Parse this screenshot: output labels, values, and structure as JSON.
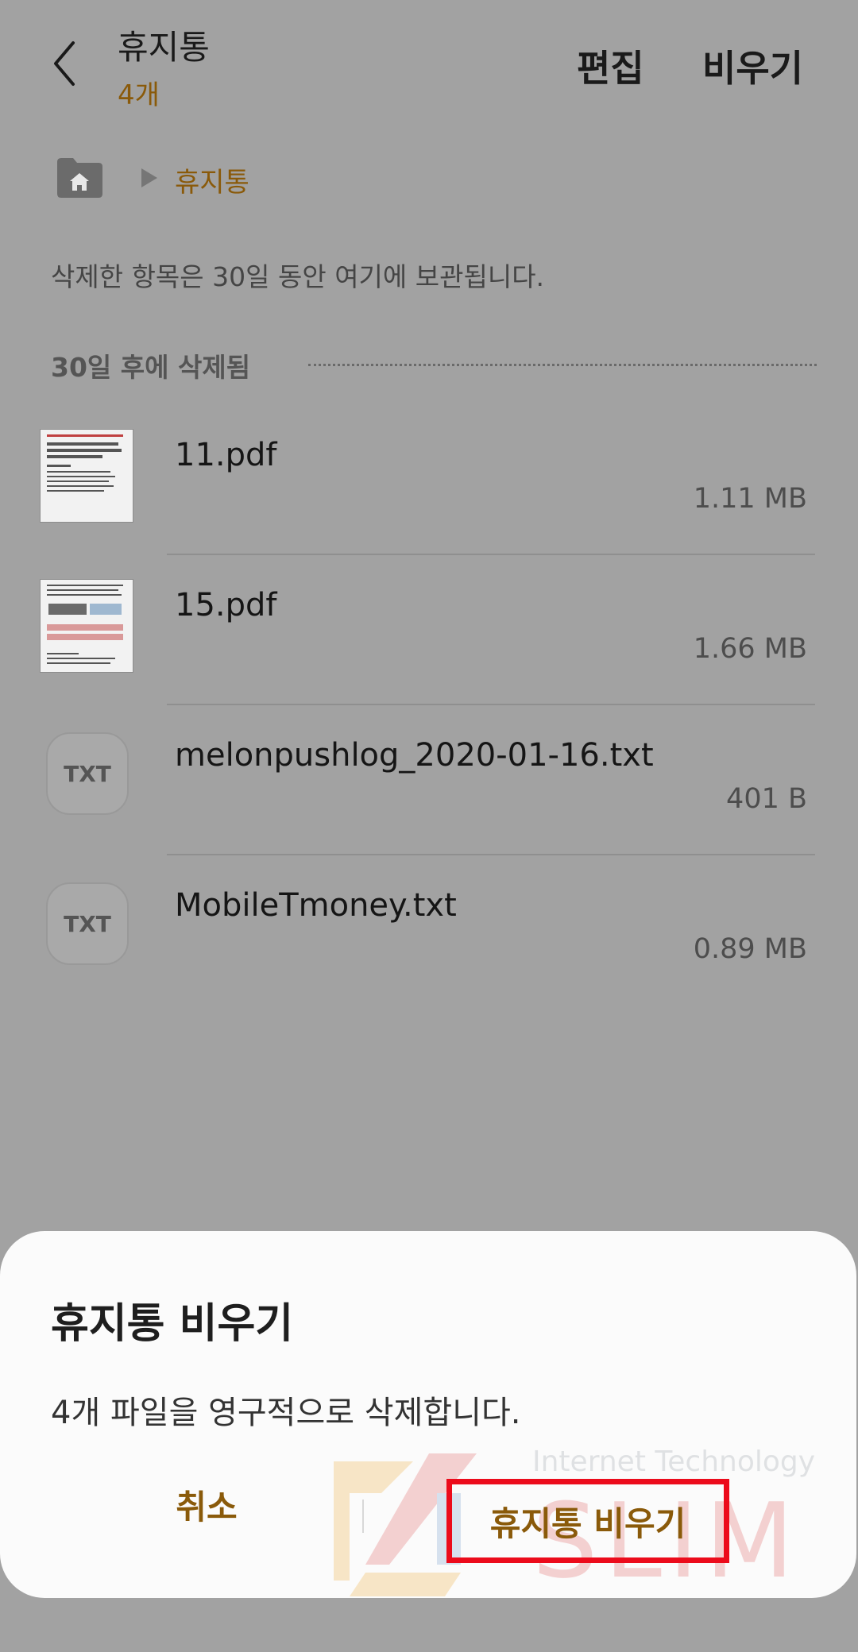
{
  "header": {
    "title": "휴지통",
    "count": "4개",
    "edit_label": "편집",
    "empty_label": "비우기"
  },
  "breadcrumb": {
    "home_icon": "home-icon",
    "current": "휴지통"
  },
  "info_text": "삭제한 항목은 30일 동안 여기에 보관됩니다.",
  "section": {
    "title": "30일 후에 삭제됨"
  },
  "files": [
    {
      "name": "11.pdf",
      "size": "1.11 MB",
      "type": "pdf"
    },
    {
      "name": "15.pdf",
      "size": "1.66 MB",
      "type": "pdf"
    },
    {
      "name": "melonpushlog_2020-01-16.txt",
      "size": "401 B",
      "type": "txt",
      "icon_label": "TXT"
    },
    {
      "name": "MobileTmoney.txt",
      "size": "0.89 MB",
      "type": "txt",
      "icon_label": "TXT"
    }
  ],
  "dialog": {
    "title": "휴지통 비우기",
    "message": "4개 파일을 영구적으로 삭제합니다.",
    "cancel_label": "취소",
    "confirm_label": "휴지통 비우기"
  },
  "watermark": {
    "subtitle": "Internet Technology",
    "main": "SLIM"
  },
  "colors": {
    "accent": "#8a5a0a",
    "highlight": "#ec0b1b",
    "dim_background": "#a2a2a2"
  }
}
